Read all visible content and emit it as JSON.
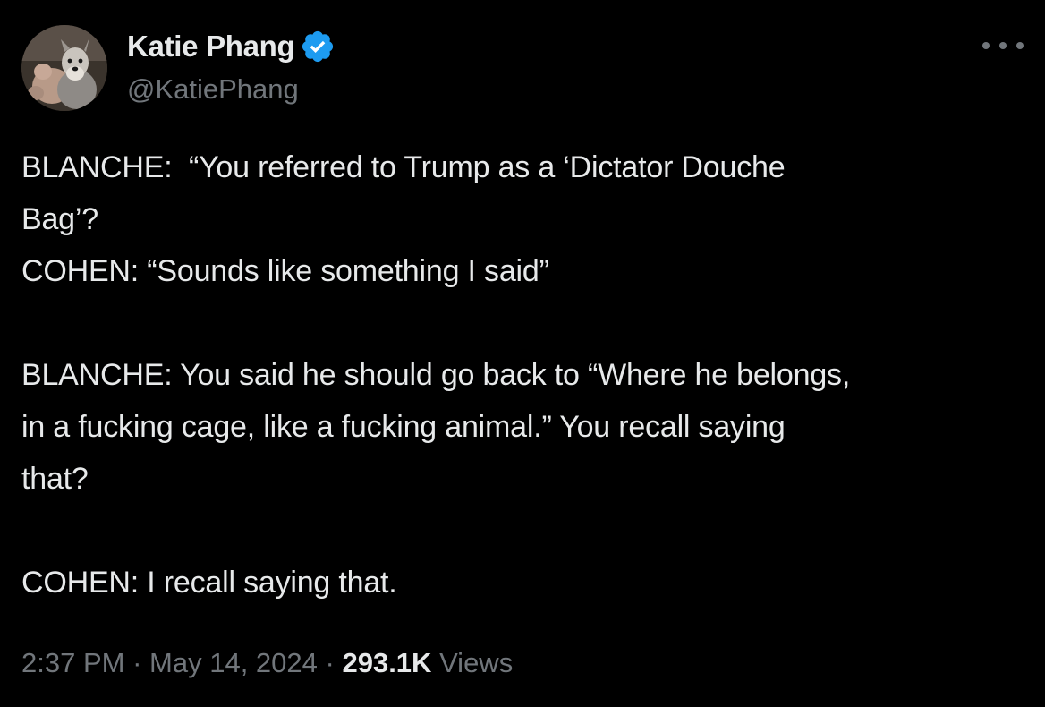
{
  "author": {
    "display_name": "Katie Phang",
    "handle": "@KatiePhang",
    "verified_icon": "verified-badge-icon",
    "avatar_icon": "avatar-dog-photo"
  },
  "more_menu_icon": "more-horizontal-icon",
  "tweet": {
    "lines": [
      "BLANCHE:  “You referred to Trump as a ‘Dictator Douche",
      "Bag’?",
      "COHEN: “Sounds like something I said”",
      "",
      "BLANCHE: You said he should go back to “Where he belongs,",
      "in a fucking cage, like a fucking animal.” You recall saying",
      "that?",
      "",
      "COHEN: I recall saying that."
    ]
  },
  "meta": {
    "time": "2:37 PM",
    "separator": "·",
    "date": "May 14, 2024",
    "views_count": "293.1K",
    "views_label": "Views"
  },
  "colors": {
    "background": "#000000",
    "text": "#e7e9ea",
    "secondary_text": "#71767b",
    "verified_blue": "#1d9bf0"
  }
}
